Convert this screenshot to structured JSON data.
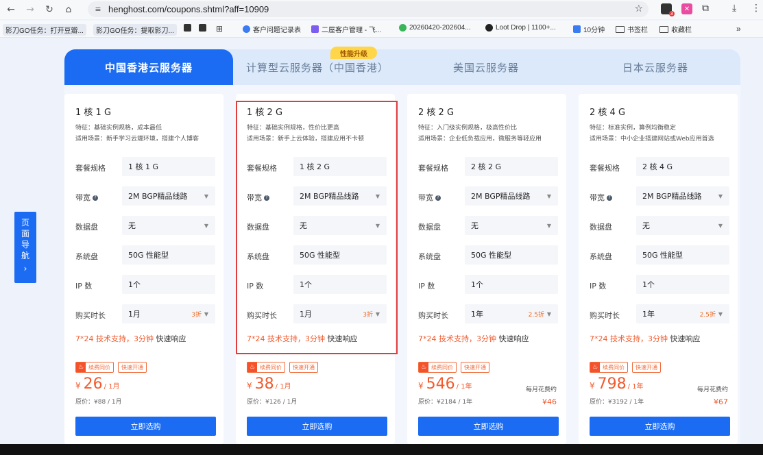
{
  "browser": {
    "url": "henghost.com/coupons.shtml?aff=10909",
    "bookmarks": [
      "影刀GO任务：打开豆瓣...",
      "影刀GO任务：提取影刀...",
      "客户问题记录表",
      "二屋客户管理 - 飞...",
      "20260420-202604...",
      "Loot Drop | 1100+...",
      "10分钟",
      "书签栏",
      "收藏栏"
    ],
    "ext_badge": "3"
  },
  "tabs": [
    "中国香港云服务器",
    "计算型云服务器（中国香港）",
    "美国云服务器",
    "日本云服务器"
  ],
  "tab_badge": "性能升级",
  "sidenav": {
    "label": [
      "页",
      "面",
      "导",
      "航"
    ],
    "arrow": "›"
  },
  "labels": {
    "spec": "套餐规格",
    "bandwidth": "带宽",
    "data_disk": "数据盘",
    "system_disk": "系统盘",
    "ip": "IP 数",
    "duration": "购买时长",
    "support_a": "7*24 技术支持，",
    "support_b": "3分钟",
    "support_c": " 快速响应",
    "tag1": "续费同价",
    "tag2": "快速开通",
    "buy": "立即选购",
    "monthly": "每月花费约",
    "currency": "¥"
  },
  "cards": [
    {
      "title": "1 核 1 G",
      "feat": "特征：基础实例规格，成本最低",
      "scene": "适用场景：新手学习云端环境，搭建个人博客",
      "spec": "1 核 1 G",
      "bw": "2M BGP精品线路",
      "disk": "无",
      "sys": "50G 性能型",
      "ip": "1个",
      "dur": "1月",
      "disc": "3折",
      "price": "26",
      "unit": "/ 1月",
      "orig": "原价：¥88 / 1月",
      "monthly": ""
    },
    {
      "title": "1 核 2 G",
      "feat": "特征：基础实例规格，性价比更高",
      "scene": "适用场景：新手上云体验，搭建应用不卡顿",
      "spec": "1 核 2 G",
      "bw": "2M BGP精品线路",
      "disk": "无",
      "sys": "50G 性能型",
      "ip": "1个",
      "dur": "1月",
      "disc": "3折",
      "price": "38",
      "unit": "/ 1月",
      "orig": "原价：¥126 / 1月",
      "monthly": ""
    },
    {
      "title": "2 核 2 G",
      "feat": "特征：入门级实例规格，极高性价比",
      "scene": "适用场景：企业低负载应用，微服务等轻应用",
      "spec": "2 核 2 G",
      "bw": "2M BGP精品线路",
      "disk": "无",
      "sys": "50G 性能型",
      "ip": "1个",
      "dur": "1年",
      "disc": "2.5折",
      "price": "546",
      "unit": "/ 1年",
      "orig": "原价：¥2184 / 1年",
      "monthly": "¥46"
    },
    {
      "title": "2 核 4 G",
      "feat": "特征：标准实例，算例均衡稳定",
      "scene": "适用场景：中小企业搭建网站或Web应用首选",
      "spec": "2 核 4 G",
      "bw": "2M BGP精品线路",
      "disk": "无",
      "sys": "50G 性能型",
      "ip": "1个",
      "dur": "1年",
      "disc": "2.5折",
      "price": "798",
      "unit": "/ 1年",
      "orig": "原价：¥3192 / 1年",
      "monthly": "¥67"
    }
  ],
  "colors": {
    "primary": "#1b6cf2",
    "accent": "#f25a2c",
    "highlight": "#e33b3b"
  }
}
